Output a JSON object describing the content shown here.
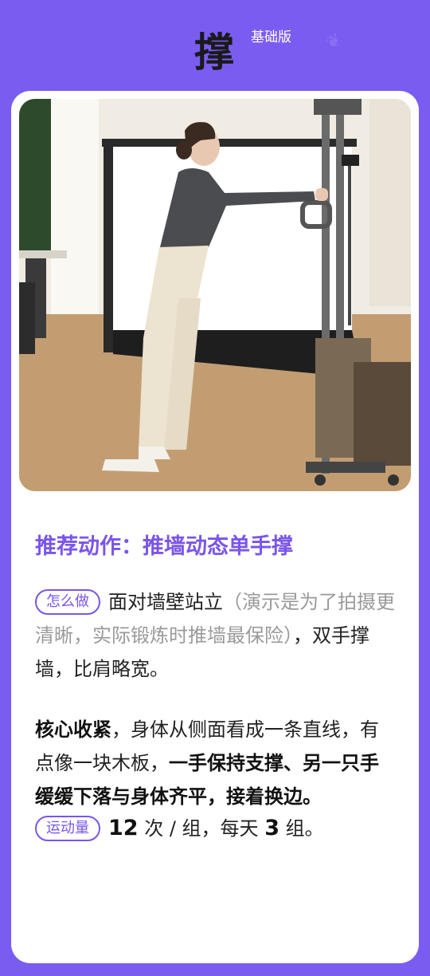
{
  "header": {
    "title": "撑",
    "badge": "基础版"
  },
  "photo": {
    "alt": ""
  },
  "card": {
    "subtitle": "推荐动作：推墙动态单手撑",
    "how_tag": "怎么做",
    "how_text_a": "面对墙壁站立",
    "how_text_muted": "（演示是为了拍摄更清晰，实际锻炼时推墙最保险）",
    "how_text_b": "，双手撑墙，比肩略宽。",
    "core_bold_1": "核心收紧",
    "core_text_1": "，身体从侧面看成一条直线，有点像一块木板，",
    "core_bold_2": "一手保持支撑、另一只手缓缓下落与身体齐平，接着换边。",
    "amount_tag": "运动量",
    "amount_num_1": "12",
    "amount_text_1": " 次 / 组，每天 ",
    "amount_num_2": "3",
    "amount_text_2": " 组。"
  },
  "colors": {
    "background": "#7a5cf0",
    "accent": "#7a55ea"
  }
}
